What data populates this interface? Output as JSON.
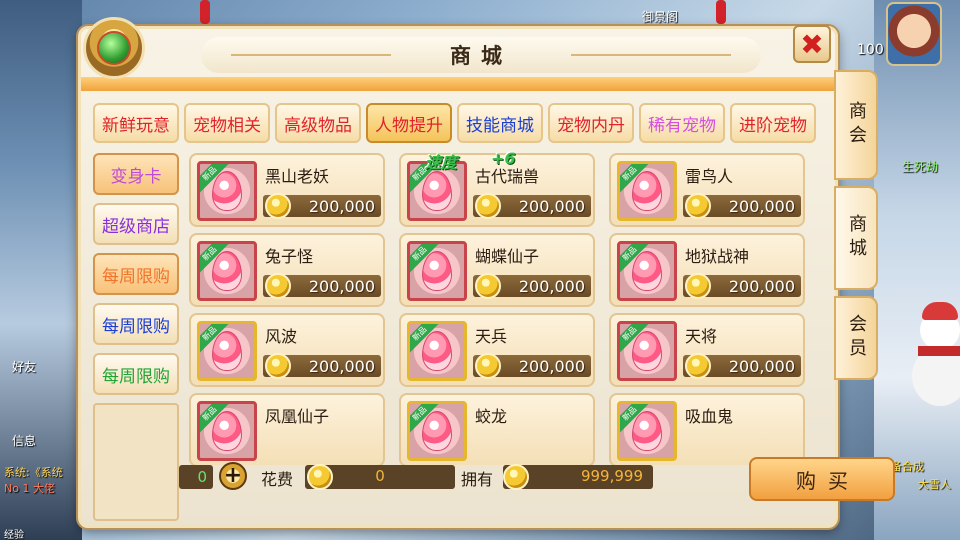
{
  "window": {
    "title": "商城"
  },
  "background": {
    "left_texts": [
      "好友",
      "信息",
      "系统:《系统",
      "No 1 大佬",
      "经验"
    ],
    "right_texts": [
      "生死劫",
      "顶级装备合成",
      "大雪人"
    ],
    "top_text": "御景阁",
    "level": "100"
  },
  "category_tabs": [
    {
      "label": "新鲜玩意",
      "color": "#e0242a"
    },
    {
      "label": "宠物相关",
      "color": "#e0242a"
    },
    {
      "label": "高级物品",
      "color": "#e0242a"
    },
    {
      "label": "人物提升",
      "color": "#e0242a"
    },
    {
      "label": "技能商城",
      "color": "#1b3fd4"
    },
    {
      "label": "宠物内丹",
      "color": "#e0242a"
    },
    {
      "label": "稀有宠物",
      "color": "#d64fe0"
    },
    {
      "label": "进阶宠物",
      "color": "#e0242a"
    }
  ],
  "sub_tabs": [
    {
      "label": "变身卡",
      "color": "#c04ad8"
    },
    {
      "label": "超级商店",
      "color": "#8a2ee0"
    },
    {
      "label": "每周限购",
      "color": "#f0742a"
    },
    {
      "label": "每周限购",
      "color": "#1b3fd4"
    },
    {
      "label": "每周限购",
      "color": "#22a336"
    }
  ],
  "new_badge": "新品",
  "items": [
    {
      "name": "黑山老妖",
      "price": "200,000",
      "frame": "red"
    },
    {
      "name": "古代瑞兽",
      "price": "200,000",
      "frame": "red"
    },
    {
      "name": "雷鸟人",
      "price": "200,000",
      "frame": "gold"
    },
    {
      "name": "兔子怪",
      "price": "200,000",
      "frame": "red"
    },
    {
      "name": "蝴蝶仙子",
      "price": "200,000",
      "frame": "red"
    },
    {
      "name": "地狱战神",
      "price": "200,000",
      "frame": "red"
    },
    {
      "name": "风波",
      "price": "200,000",
      "frame": "gold"
    },
    {
      "name": "天兵",
      "price": "200,000",
      "frame": "gold"
    },
    {
      "name": "天将",
      "price": "200,000",
      "frame": "red"
    },
    {
      "name": "凤凰仙子",
      "price": "",
      "frame": "red"
    },
    {
      "name": "蛟龙",
      "price": "",
      "frame": "gold"
    },
    {
      "name": "吸血鬼",
      "price": "",
      "frame": "gold"
    }
  ],
  "floating_text": {
    "label": "速度",
    "value": "+6"
  },
  "footer": {
    "quantity": "0",
    "cost_label": "花费",
    "cost_value": "0",
    "own_label": "拥有",
    "own_value": "999,999",
    "buy_label": "购买"
  },
  "side_tabs": [
    {
      "label": "商会"
    },
    {
      "label": "商城"
    },
    {
      "label": "会员"
    }
  ],
  "close_symbol": "✖"
}
